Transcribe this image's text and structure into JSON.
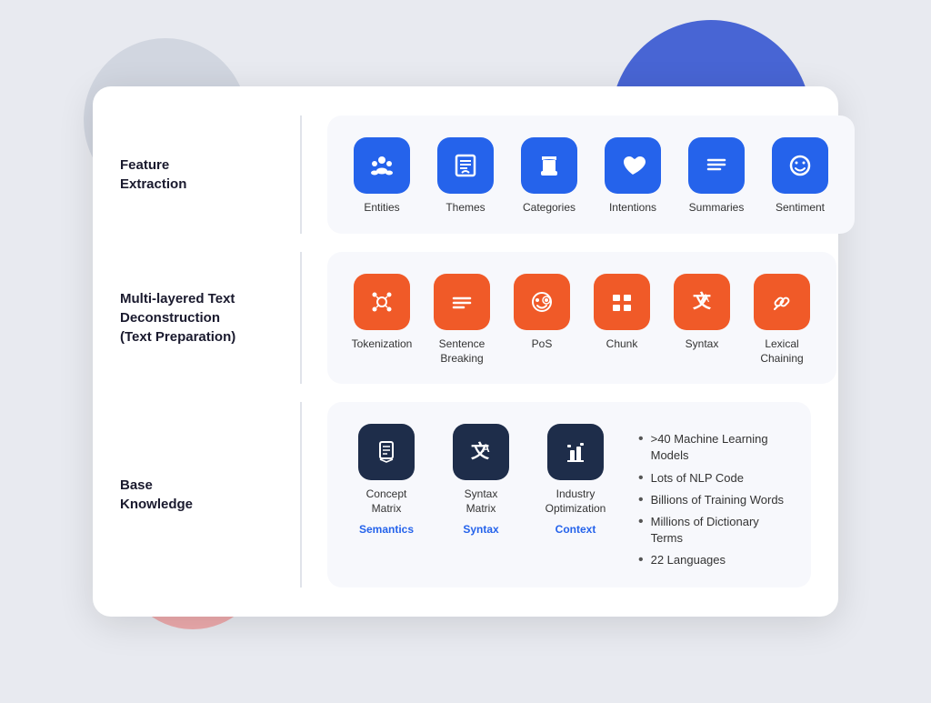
{
  "decorative": {
    "circle_gray": "gray circle",
    "circle_blue": "blue circle",
    "circle_pink": "pink circle"
  },
  "rows": [
    {
      "id": "feature-extraction",
      "label": "Feature\nExtraction",
      "items": [
        {
          "id": "entities",
          "label": "Entities",
          "icon": "people",
          "color": "blue"
        },
        {
          "id": "themes",
          "label": "Themes",
          "icon": "book",
          "color": "blue"
        },
        {
          "id": "categories",
          "label": "Categories",
          "icon": "stack",
          "color": "blue"
        },
        {
          "id": "intentions",
          "label": "Intentions",
          "icon": "heart",
          "color": "blue"
        },
        {
          "id": "summaries",
          "label": "Summaries",
          "icon": "lines",
          "color": "blue"
        },
        {
          "id": "sentiment",
          "label": "Sentiment",
          "icon": "smile",
          "color": "blue"
        }
      ]
    },
    {
      "id": "text-deconstruction",
      "label": "Multi-layered Text\nDeconstruction\n(Text Preparation)",
      "items": [
        {
          "id": "tokenization",
          "label": "Tokenization",
          "icon": "share",
          "color": "orange"
        },
        {
          "id": "sentence-breaking",
          "label": "Sentence\nBreaking",
          "icon": "menu",
          "color": "orange"
        },
        {
          "id": "pos",
          "label": "PoS",
          "icon": "chat",
          "color": "orange"
        },
        {
          "id": "chunk",
          "label": "Chunk",
          "icon": "grid",
          "color": "orange"
        },
        {
          "id": "syntax",
          "label": "Syntax",
          "icon": "translate",
          "color": "orange"
        },
        {
          "id": "lexical-chaining",
          "label": "Lexical\nChaining",
          "icon": "link",
          "color": "orange"
        }
      ]
    }
  ],
  "base_knowledge": {
    "label": "Base\nKnowledge",
    "icons": [
      {
        "id": "concept-matrix",
        "label": "Concept\nMatrix",
        "sublabel": "Semantics",
        "icon": "document",
        "color": "dark"
      },
      {
        "id": "syntax-matrix",
        "label": "Syntax\nMatrix",
        "sublabel": "Syntax",
        "icon": "translate",
        "color": "dark"
      },
      {
        "id": "industry-opt",
        "label": "Industry\nOptimization",
        "sublabel": "Context",
        "icon": "building",
        "color": "dark"
      }
    ],
    "bullets": [
      ">40 Machine Learning Models",
      "Lots of NLP Code",
      "Billions of Training Words",
      "Millions of Dictionary Terms",
      "22 Languages"
    ]
  }
}
